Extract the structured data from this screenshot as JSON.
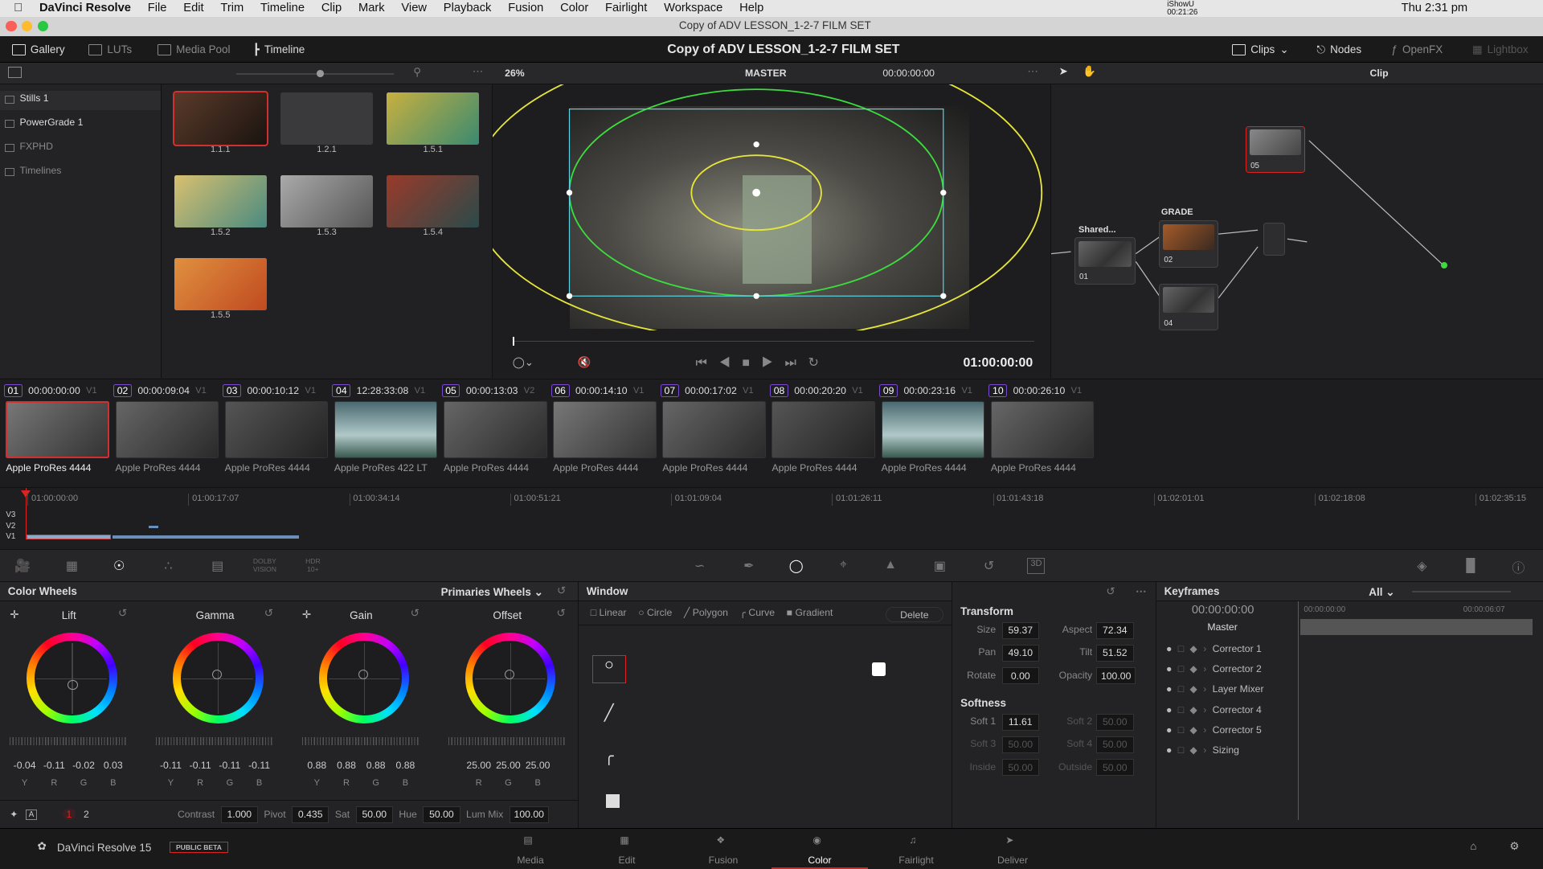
{
  "menubar": {
    "app": "DaVinci Resolve",
    "items": [
      "File",
      "Edit",
      "Trim",
      "Timeline",
      "Clip",
      "Mark",
      "View",
      "Playback",
      "Fusion",
      "Color",
      "Fairlight",
      "Workspace",
      "Help"
    ],
    "recorder": "iShowU",
    "recorder_time": "00:21:26",
    "clock": "Thu 2:31 pm"
  },
  "window": {
    "title": "Copy of ADV LESSON_1-2-7 FILM SET"
  },
  "toolbar": {
    "left": [
      "Gallery",
      "LUTs",
      "Media Pool",
      "Timeline"
    ],
    "project_title": "Copy of ADV LESSON_1-2-7 FILM SET",
    "right": [
      "Clips",
      "Nodes",
      "OpenFX",
      "Lightbox"
    ]
  },
  "viewer_bar": {
    "zoom": "26%",
    "timeline": "MASTER",
    "timecode": "00:00:00:00",
    "node_mode": "Clip"
  },
  "gallery": {
    "albums": [
      "Stills 1",
      "PowerGrade 1",
      "FXPHD",
      "Timelines"
    ],
    "stills": [
      "1.1.1",
      "1.2.1",
      "1.5.1",
      "1.5.2",
      "1.5.3",
      "1.5.4",
      "1.5.5"
    ]
  },
  "viewer": {
    "timecode": "01:00:00:00"
  },
  "nodes": [
    {
      "label": "01",
      "title": "Shared..."
    },
    {
      "label": "02",
      "title": "GRADE"
    },
    {
      "label": "04",
      "title": ""
    },
    {
      "label": "05",
      "title": ""
    }
  ],
  "clips": [
    {
      "num": "01",
      "tc": "00:00:00:00",
      "track": "V1",
      "codec": "Apple ProRes 4444"
    },
    {
      "num": "02",
      "tc": "00:00:09:04",
      "track": "V1",
      "codec": "Apple ProRes 4444"
    },
    {
      "num": "03",
      "tc": "00:00:10:12",
      "track": "V1",
      "codec": "Apple ProRes 4444"
    },
    {
      "num": "04",
      "tc": "12:28:33:08",
      "track": "V1",
      "codec": "Apple ProRes 422 LT"
    },
    {
      "num": "05",
      "tc": "00:00:13:03",
      "track": "V2",
      "codec": "Apple ProRes 4444"
    },
    {
      "num": "06",
      "tc": "00:00:14:10",
      "track": "V1",
      "codec": "Apple ProRes 4444"
    },
    {
      "num": "07",
      "tc": "00:00:17:02",
      "track": "V1",
      "codec": "Apple ProRes 4444"
    },
    {
      "num": "08",
      "tc": "00:00:20:20",
      "track": "V1",
      "codec": "Apple ProRes 4444"
    },
    {
      "num": "09",
      "tc": "00:00:23:16",
      "track": "V1",
      "codec": "Apple ProRes 4444"
    },
    {
      "num": "10",
      "tc": "00:00:26:10",
      "track": "V1",
      "codec": "Apple ProRes 4444"
    }
  ],
  "timeline": {
    "ticks": [
      "01:00:00:00",
      "01:00:17:07",
      "01:00:34:14",
      "01:00:51:21",
      "01:01:09:04",
      "01:01:26:11",
      "01:01:43:18",
      "01:02:01:01",
      "01:02:18:08",
      "01:02:35:15"
    ],
    "tracks": [
      "V3",
      "V2",
      "V1"
    ]
  },
  "palette": {
    "dolby": "DOLBY VISION",
    "hdr": "HDR 10+"
  },
  "color_wheels": {
    "title": "Color Wheels",
    "mode": "Primaries Wheels",
    "wheels": [
      {
        "name": "Lift",
        "values": [
          "-0.04",
          "-0.11",
          "-0.02",
          "0.03"
        ],
        "channels": [
          "Y",
          "R",
          "G",
          "B"
        ]
      },
      {
        "name": "Gamma",
        "values": [
          "-0.11",
          "-0.11",
          "-0.11",
          "-0.11"
        ],
        "channels": [
          "Y",
          "R",
          "G",
          "B"
        ]
      },
      {
        "name": "Gain",
        "values": [
          "0.88",
          "0.88",
          "0.88",
          "0.88"
        ],
        "channels": [
          "Y",
          "R",
          "G",
          "B"
        ]
      },
      {
        "name": "Offset",
        "values": [
          "25.00",
          "25.00",
          "25.00"
        ],
        "channels": [
          "R",
          "G",
          "B"
        ]
      }
    ],
    "pages": [
      "1",
      "2"
    ],
    "params": [
      {
        "label": "Contrast",
        "value": "1.000"
      },
      {
        "label": "Pivot",
        "value": "0.435"
      },
      {
        "label": "Sat",
        "value": "50.00"
      },
      {
        "label": "Hue",
        "value": "50.00"
      },
      {
        "label": "Lum Mix",
        "value": "100.00"
      }
    ]
  },
  "window_panel": {
    "title": "Window",
    "shapes": [
      "Linear",
      "Circle",
      "Polygon",
      "Curve",
      "Gradient"
    ],
    "delete": "Delete"
  },
  "transform": {
    "title": "Transform",
    "rows": [
      [
        {
          "label": "Size",
          "value": "59.37"
        },
        {
          "label": "Aspect",
          "value": "72.34"
        }
      ],
      [
        {
          "label": "Pan",
          "value": "49.10"
        },
        {
          "label": "Tilt",
          "value": "51.52"
        }
      ],
      [
        {
          "label": "Rotate",
          "value": "0.00"
        },
        {
          "label": "Opacity",
          "value": "100.00"
        }
      ]
    ],
    "softness_title": "Softness",
    "softness": [
      [
        {
          "label": "Soft 1",
          "value": "11.61"
        },
        {
          "label": "Soft 2",
          "value": "50.00"
        }
      ],
      [
        {
          "label": "Soft 3",
          "value": "50.00"
        },
        {
          "label": "Soft 4",
          "value": "50.00"
        }
      ],
      [
        {
          "label": "Inside",
          "value": "50.00"
        },
        {
          "label": "Outside",
          "value": "50.00"
        }
      ]
    ]
  },
  "keyframes": {
    "title": "Keyframes",
    "filter": "All",
    "timecode": "00:00:00:00",
    "ruler_start": "00:00:00:00",
    "ruler_end": "00:00:06:07",
    "master": "Master",
    "rows": [
      "Corrector 1",
      "Corrector 2",
      "Layer Mixer",
      "Corrector 4",
      "Corrector 5",
      "Sizing"
    ]
  },
  "footer": {
    "app": "DaVinci Resolve 15",
    "badge": "PUBLIC BETA",
    "pages": [
      "Media",
      "Edit",
      "Fusion",
      "Color",
      "Fairlight",
      "Deliver"
    ],
    "active": "Color"
  },
  "colors": {
    "accent": "#d22a2a",
    "window_green": "#3ddc3d",
    "window_yellow": "#e5e53a",
    "clip_num": "#7a4bd0"
  }
}
